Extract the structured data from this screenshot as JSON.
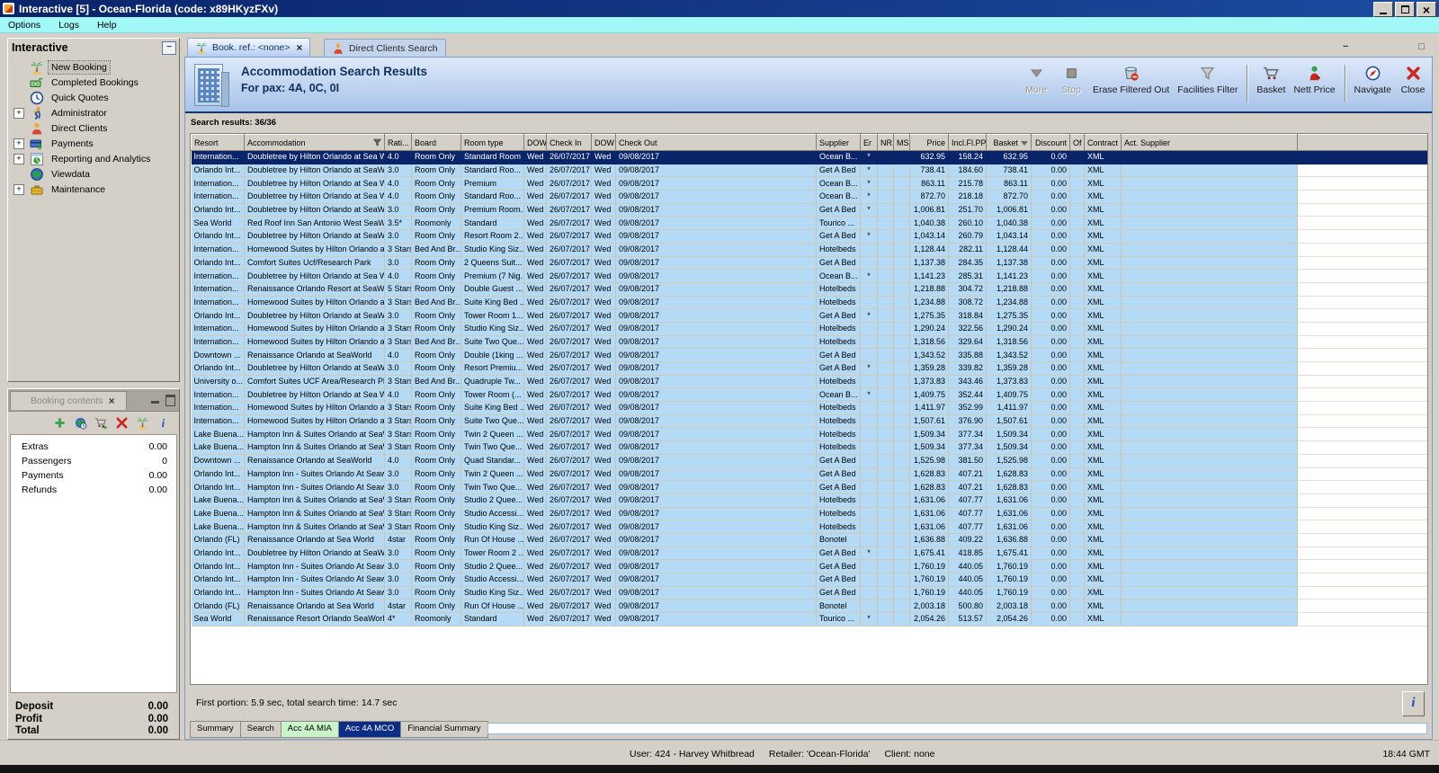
{
  "window": {
    "title": "Interactive [5] - Ocean-Florida (code: x89HKyzFXv)",
    "menu": [
      "Options",
      "Logs",
      "Help"
    ]
  },
  "sidebar": {
    "title": "Interactive",
    "items": [
      {
        "label": "New Booking",
        "icon": "palm",
        "expandable": false,
        "selected": true
      },
      {
        "label": "Completed Bookings",
        "icon": "money",
        "expandable": false,
        "selected": false
      },
      {
        "label": "Quick Quotes",
        "icon": "clock",
        "expandable": false,
        "selected": false
      },
      {
        "label": "Administrator",
        "icon": "runner",
        "expandable": true,
        "selected": false
      },
      {
        "label": "Direct Clients",
        "icon": "person",
        "expandable": false,
        "selected": false
      },
      {
        "label": "Payments",
        "icon": "card",
        "expandable": true,
        "selected": false
      },
      {
        "label": "Reporting and Analytics",
        "icon": "report",
        "expandable": true,
        "selected": false
      },
      {
        "label": "Viewdata",
        "icon": "globe",
        "expandable": false,
        "selected": false
      },
      {
        "label": "Maintenance",
        "icon": "toolbox",
        "expandable": true,
        "selected": false
      }
    ]
  },
  "booking_contents": {
    "tab_title": "Booking contents",
    "toolbar_icons": [
      "add",
      "world",
      "cart-go",
      "delete-x",
      "palm",
      "info"
    ],
    "rows": [
      {
        "label": "Extras",
        "value": "0.00"
      },
      {
        "label": "Passengers",
        "value": "0"
      },
      {
        "label": "Payments",
        "value": "0.00"
      },
      {
        "label": "Refunds",
        "value": "0.00"
      }
    ],
    "totals": [
      {
        "label": "Deposit",
        "value": "0.00"
      },
      {
        "label": "Profit",
        "value": "0.00"
      },
      {
        "label": "Total",
        "value": "0.00"
      }
    ]
  },
  "main": {
    "tabs": [
      {
        "label": "Book. ref.: <none>",
        "icon": "palm",
        "active": true,
        "closable": true
      },
      {
        "label": "Direct Clients Search",
        "icon": "person",
        "active": false,
        "closable": false
      }
    ],
    "header": {
      "title": "Accommodation Search Results",
      "subtitle": "For pax: 4A, 0C, 0I"
    },
    "toolbar": [
      {
        "label": "More",
        "icon": "more",
        "disabled": true,
        "group_end": false
      },
      {
        "label": "Stop",
        "icon": "stop",
        "disabled": true,
        "group_end": false
      },
      {
        "label": "Erase Filtered Out",
        "icon": "erase",
        "disabled": false,
        "group_end": false
      },
      {
        "label": "Facilities Filter",
        "icon": "funnel",
        "disabled": false,
        "group_end": true
      },
      {
        "label": "Basket",
        "icon": "basket",
        "disabled": false,
        "group_end": false
      },
      {
        "label": "Nett Price",
        "icon": "nett-price",
        "disabled": false,
        "group_end": true
      },
      {
        "label": "Navigate",
        "icon": "navigate",
        "disabled": false,
        "group_end": false
      },
      {
        "label": "Close",
        "icon": "close-x",
        "disabled": false,
        "group_end": false
      }
    ],
    "results_label": "Search results: 36/36",
    "footer_note": "First portion: 5.9 sec, total search time: 14.7 sec",
    "info_button": "i",
    "bottom_tabs": [
      {
        "label": "Summary",
        "style": "plain"
      },
      {
        "label": "Search",
        "style": "plain"
      },
      {
        "label": "Acc 4A MIA",
        "style": "green"
      },
      {
        "label": "Acc 4A MCO",
        "style": "blue"
      },
      {
        "label": "Financial Summary",
        "style": "plain"
      }
    ]
  },
  "table": {
    "columns": [
      "Resort",
      "Accommodation",
      "Rati...",
      "Board",
      "Room type",
      "DOW",
      "Check In",
      "DOW",
      "Check Out",
      "Supplier",
      "Er",
      "NR",
      "MS",
      "Price",
      "Incl.Fl.PP",
      "Basket",
      "Discount",
      "Of",
      "Contract",
      "Act. Supplier"
    ],
    "selected_row": 0,
    "rows": [
      [
        "Internation...",
        "Doubletree by Hilton Orlando at Sea World",
        "4.0",
        "Room Only",
        "Standard Room",
        "Wed",
        "26/07/2017",
        "Wed",
        "09/08/2017",
        "Ocean B...",
        "*",
        "",
        "",
        "632.95",
        "158.24",
        "632.95",
        "0.00",
        "",
        "XML",
        ""
      ],
      [
        "Orlando Int...",
        "Doubletree by Hilton Orlando at SeaWorld",
        "3.0",
        "Room Only",
        "Standard Roo...",
        "Wed",
        "26/07/2017",
        "Wed",
        "09/08/2017",
        "Get A Bed",
        "*",
        "",
        "",
        "738.41",
        "184.60",
        "738.41",
        "0.00",
        "",
        "XML",
        ""
      ],
      [
        "Internation...",
        "Doubletree by Hilton Orlando at Sea World",
        "4.0",
        "Room Only",
        "Premium",
        "Wed",
        "26/07/2017",
        "Wed",
        "09/08/2017",
        "Ocean B...",
        "*",
        "",
        "",
        "863.11",
        "215.78",
        "863.11",
        "0.00",
        "",
        "XML",
        ""
      ],
      [
        "Internation...",
        "Doubletree by Hilton Orlando at Sea World",
        "4.0",
        "Room Only",
        "Standard Roo...",
        "Wed",
        "26/07/2017",
        "Wed",
        "09/08/2017",
        "Ocean B...",
        "*",
        "",
        "",
        "872.70",
        "218.18",
        "872.70",
        "0.00",
        "",
        "XML",
        ""
      ],
      [
        "Orlando Int...",
        "Doubletree by Hilton Orlando at SeaWorld",
        "3.0",
        "Room Only",
        "Premium Room...",
        "Wed",
        "26/07/2017",
        "Wed",
        "09/08/2017",
        "Get A Bed",
        "*",
        "",
        "",
        "1,006.81",
        "251.70",
        "1,006.81",
        "0.00",
        "",
        "XML",
        ""
      ],
      [
        "Sea World",
        "Red Roof Inn San Antonio West SeaWorld",
        "3.5*",
        "Roomonly",
        "Standard",
        "Wed",
        "26/07/2017",
        "Wed",
        "09/08/2017",
        "Tourico ...",
        "",
        "",
        "",
        "1,040.38",
        "260.10",
        "1,040.38",
        "0.00",
        "",
        "XML",
        ""
      ],
      [
        "Orlando Int...",
        "Doubletree by Hilton Orlando at SeaWorld",
        "3.0",
        "Room Only",
        "Resort Room 2...",
        "Wed",
        "26/07/2017",
        "Wed",
        "09/08/2017",
        "Get A Bed",
        "*",
        "",
        "",
        "1,043.14",
        "260.79",
        "1,043.14",
        "0.00",
        "",
        "XML",
        ""
      ],
      [
        "Internation...",
        "Homewood Suites by Hilton Orlando at ...",
        "3 Stars",
        "Bed And Br...",
        "Studio King Siz...",
        "Wed",
        "26/07/2017",
        "Wed",
        "09/08/2017",
        "Hotelbeds",
        "",
        "",
        "",
        "1,128.44",
        "282.11",
        "1,128.44",
        "0.00",
        "",
        "XML",
        ""
      ],
      [
        "Orlando Int...",
        "Comfort Suites Ucf/Research Park",
        "3.0",
        "Room Only",
        "2 Queens Suit...",
        "Wed",
        "26/07/2017",
        "Wed",
        "09/08/2017",
        "Get A Bed",
        "",
        "",
        "",
        "1,137.38",
        "284.35",
        "1,137.38",
        "0.00",
        "",
        "XML",
        ""
      ],
      [
        "Internation...",
        "Doubletree by Hilton Orlando at Sea World",
        "4.0",
        "Room Only",
        "Premium (7 Nig...",
        "Wed",
        "26/07/2017",
        "Wed",
        "09/08/2017",
        "Ocean B...",
        "*",
        "",
        "",
        "1,141.23",
        "285.31",
        "1,141.23",
        "0.00",
        "",
        "XML",
        ""
      ],
      [
        "Internation...",
        "Renaissance Orlando Resort at SeaWorld",
        "5 Stars",
        "Room Only",
        "Double Guest ...",
        "Wed",
        "26/07/2017",
        "Wed",
        "09/08/2017",
        "Hotelbeds",
        "",
        "",
        "",
        "1,218.88",
        "304.72",
        "1,218.88",
        "0.00",
        "",
        "XML",
        ""
      ],
      [
        "Internation...",
        "Homewood Suites by Hilton Orlando at ...",
        "3 Stars",
        "Bed And Br...",
        "Suite King Bed ...",
        "Wed",
        "26/07/2017",
        "Wed",
        "09/08/2017",
        "Hotelbeds",
        "",
        "",
        "",
        "1,234.88",
        "308.72",
        "1,234.88",
        "0.00",
        "",
        "XML",
        ""
      ],
      [
        "Orlando Int...",
        "Doubletree by Hilton Orlando at SeaWorld",
        "3.0",
        "Room Only",
        "Tower Room 1...",
        "Wed",
        "26/07/2017",
        "Wed",
        "09/08/2017",
        "Get A Bed",
        "*",
        "",
        "",
        "1,275.35",
        "318.84",
        "1,275.35",
        "0.00",
        "",
        "XML",
        ""
      ],
      [
        "Internation...",
        "Homewood Suites by Hilton Orlando at ...",
        "3 Stars",
        "Room Only",
        "Studio King Siz...",
        "Wed",
        "26/07/2017",
        "Wed",
        "09/08/2017",
        "Hotelbeds",
        "",
        "",
        "",
        "1,290.24",
        "322.56",
        "1,290.24",
        "0.00",
        "",
        "XML",
        ""
      ],
      [
        "Internation...",
        "Homewood Suites by Hilton Orlando at ...",
        "3 Stars",
        "Bed And Br...",
        "Suite Two Que...",
        "Wed",
        "26/07/2017",
        "Wed",
        "09/08/2017",
        "Hotelbeds",
        "",
        "",
        "",
        "1,318.56",
        "329.64",
        "1,318.56",
        "0.00",
        "",
        "XML",
        ""
      ],
      [
        "Downtown ...",
        "Renaissance Orlando at SeaWorld",
        "4.0",
        "Room Only",
        "Double (1king ...",
        "Wed",
        "26/07/2017",
        "Wed",
        "09/08/2017",
        "Get A Bed",
        "",
        "",
        "",
        "1,343.52",
        "335.88",
        "1,343.52",
        "0.00",
        "",
        "XML",
        ""
      ],
      [
        "Orlando Int...",
        "Doubletree by Hilton Orlando at SeaWorld",
        "3.0",
        "Room Only",
        "Resort Premiu...",
        "Wed",
        "26/07/2017",
        "Wed",
        "09/08/2017",
        "Get A Bed",
        "*",
        "",
        "",
        "1,359.28",
        "339.82",
        "1,359.28",
        "0.00",
        "",
        "XML",
        ""
      ],
      [
        "University o...",
        "Comfort Suites UCF Area/Research Pk",
        "3 Stars",
        "Bed And Br...",
        "Quadruple Tw...",
        "Wed",
        "26/07/2017",
        "Wed",
        "09/08/2017",
        "Hotelbeds",
        "",
        "",
        "",
        "1,373.83",
        "343.46",
        "1,373.83",
        "0.00",
        "",
        "XML",
        ""
      ],
      [
        "Internation...",
        "Doubletree by Hilton Orlando at Sea World",
        "4.0",
        "Room Only",
        "Tower Room (...",
        "Wed",
        "26/07/2017",
        "Wed",
        "09/08/2017",
        "Ocean B...",
        "*",
        "",
        "",
        "1,409.75",
        "352.44",
        "1,409.75",
        "0.00",
        "",
        "XML",
        ""
      ],
      [
        "Internation...",
        "Homewood Suites by Hilton Orlando at ...",
        "3 Stars",
        "Room Only",
        "Suite King Bed ...",
        "Wed",
        "26/07/2017",
        "Wed",
        "09/08/2017",
        "Hotelbeds",
        "",
        "",
        "",
        "1,411.97",
        "352.99",
        "1,411.97",
        "0.00",
        "",
        "XML",
        ""
      ],
      [
        "Internation...",
        "Homewood Suites by Hilton Orlando at ...",
        "3 Stars",
        "Room Only",
        "Suite Two Que...",
        "Wed",
        "26/07/2017",
        "Wed",
        "09/08/2017",
        "Hotelbeds",
        "",
        "",
        "",
        "1,507.61",
        "376.90",
        "1,507.61",
        "0.00",
        "",
        "XML",
        ""
      ],
      [
        "Lake Buena...",
        "Hampton Inn & Suites Orlando at SeaW...",
        "3 Stars",
        "Room Only",
        "Twin 2 Queen ...",
        "Wed",
        "26/07/2017",
        "Wed",
        "09/08/2017",
        "Hotelbeds",
        "",
        "",
        "",
        "1,509.34",
        "377.34",
        "1,509.34",
        "0.00",
        "",
        "XML",
        ""
      ],
      [
        "Lake Buena...",
        "Hampton Inn & Suites Orlando at SeaW...",
        "3 Stars",
        "Room Only",
        "Twin Two Que...",
        "Wed",
        "26/07/2017",
        "Wed",
        "09/08/2017",
        "Hotelbeds",
        "",
        "",
        "",
        "1,509.34",
        "377.34",
        "1,509.34",
        "0.00",
        "",
        "XML",
        ""
      ],
      [
        "Downtown ...",
        "Renaissance Orlando at SeaWorld",
        "4.0",
        "Room Only",
        "Quad Standar...",
        "Wed",
        "26/07/2017",
        "Wed",
        "09/08/2017",
        "Get A Bed",
        "",
        "",
        "",
        "1,525.98",
        "381.50",
        "1,525.98",
        "0.00",
        "",
        "XML",
        ""
      ],
      [
        "Orlando Int...",
        "Hampton Inn - Suites Orlando At Seawo...",
        "3.0",
        "Room Only",
        "Twin 2 Queen ...",
        "Wed",
        "26/07/2017",
        "Wed",
        "09/08/2017",
        "Get A Bed",
        "",
        "",
        "",
        "1,628.83",
        "407.21",
        "1,628.83",
        "0.00",
        "",
        "XML",
        ""
      ],
      [
        "Orlando Int...",
        "Hampton Inn - Suites Orlando At Seawo...",
        "3.0",
        "Room Only",
        "Twin Two Que...",
        "Wed",
        "26/07/2017",
        "Wed",
        "09/08/2017",
        "Get A Bed",
        "",
        "",
        "",
        "1,628.83",
        "407.21",
        "1,628.83",
        "0.00",
        "",
        "XML",
        ""
      ],
      [
        "Lake Buena...",
        "Hampton Inn & Suites Orlando at SeaW...",
        "3 Stars",
        "Room Only",
        "Studio 2 Quee...",
        "Wed",
        "26/07/2017",
        "Wed",
        "09/08/2017",
        "Hotelbeds",
        "",
        "",
        "",
        "1,631.06",
        "407.77",
        "1,631.06",
        "0.00",
        "",
        "XML",
        ""
      ],
      [
        "Lake Buena...",
        "Hampton Inn & Suites Orlando at SeaW...",
        "3 Stars",
        "Room Only",
        "Studio Accessi...",
        "Wed",
        "26/07/2017",
        "Wed",
        "09/08/2017",
        "Hotelbeds",
        "",
        "",
        "",
        "1,631.06",
        "407.77",
        "1,631.06",
        "0.00",
        "",
        "XML",
        ""
      ],
      [
        "Lake Buena...",
        "Hampton Inn & Suites Orlando at SeaW...",
        "3 Stars",
        "Room Only",
        "Studio King Siz...",
        "Wed",
        "26/07/2017",
        "Wed",
        "09/08/2017",
        "Hotelbeds",
        "",
        "",
        "",
        "1,631.06",
        "407.77",
        "1,631.06",
        "0.00",
        "",
        "XML",
        ""
      ],
      [
        "Orlando (FL)",
        "Renaissance Orlando at Sea World",
        "4star",
        "Room Only",
        "Run Of House ...",
        "Wed",
        "26/07/2017",
        "Wed",
        "09/08/2017",
        "Bonotel",
        "",
        "",
        "",
        "1,636.88",
        "409.22",
        "1,636.88",
        "0.00",
        "",
        "XML",
        ""
      ],
      [
        "Orlando Int...",
        "Doubletree by Hilton Orlando at SeaWorld",
        "3.0",
        "Room Only",
        "Tower Room 2 ...",
        "Wed",
        "26/07/2017",
        "Wed",
        "09/08/2017",
        "Get A Bed",
        "*",
        "",
        "",
        "1,675.41",
        "418.85",
        "1,675.41",
        "0.00",
        "",
        "XML",
        ""
      ],
      [
        "Orlando Int...",
        "Hampton Inn - Suites Orlando At Seawo...",
        "3.0",
        "Room Only",
        "Studio 2 Quee...",
        "Wed",
        "26/07/2017",
        "Wed",
        "09/08/2017",
        "Get A Bed",
        "",
        "",
        "",
        "1,760.19",
        "440.05",
        "1,760.19",
        "0.00",
        "",
        "XML",
        ""
      ],
      [
        "Orlando Int...",
        "Hampton Inn - Suites Orlando At Seawo...",
        "3.0",
        "Room Only",
        "Studio Accessi...",
        "Wed",
        "26/07/2017",
        "Wed",
        "09/08/2017",
        "Get A Bed",
        "",
        "",
        "",
        "1,760.19",
        "440.05",
        "1,760.19",
        "0.00",
        "",
        "XML",
        ""
      ],
      [
        "Orlando Int...",
        "Hampton Inn - Suites Orlando At Seawo...",
        "3.0",
        "Room Only",
        "Studio King Siz...",
        "Wed",
        "26/07/2017",
        "Wed",
        "09/08/2017",
        "Get A Bed",
        "",
        "",
        "",
        "1,760.19",
        "440.05",
        "1,760.19",
        "0.00",
        "",
        "XML",
        ""
      ],
      [
        "Orlando (FL)",
        "Renaissance Orlando at Sea World",
        "4star",
        "Room Only",
        "Run Of House ...",
        "Wed",
        "26/07/2017",
        "Wed",
        "09/08/2017",
        "Bonotel",
        "",
        "",
        "",
        "2,003.18",
        "500.80",
        "2,003.18",
        "0.00",
        "",
        "XML",
        ""
      ],
      [
        "Sea World",
        "Renaissance Resort Orlando SeaWorld",
        "4*",
        "Roomonly",
        "Standard",
        "Wed",
        "26/07/2017",
        "Wed",
        "09/08/2017",
        "Tourico ...",
        "*",
        "",
        "",
        "2,054.26",
        "513.57",
        "2,054.26",
        "0.00",
        "",
        "XML",
        ""
      ]
    ]
  },
  "statusbar": {
    "user": "User: 424 - Harvey Whitbread",
    "retailer": "Retailer: 'Ocean-Florida'",
    "client": "Client: none",
    "clock": "18:44 GMT"
  }
}
